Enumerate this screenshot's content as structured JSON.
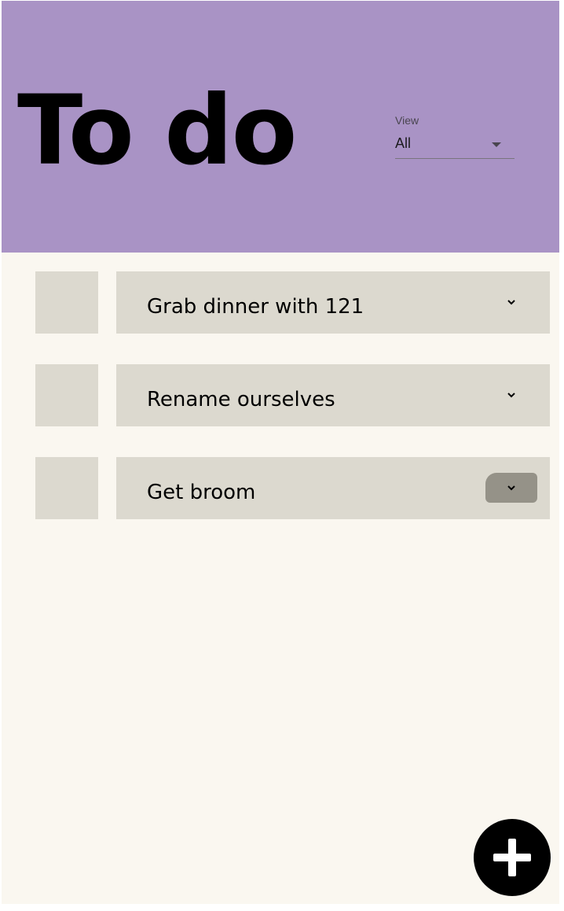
{
  "header": {
    "title": "To do",
    "background_color": "#a993c5"
  },
  "view_select": {
    "label": "View",
    "value": "All",
    "icon": "caret-down-icon"
  },
  "tasks": [
    {
      "text": "Grab dinner with 121",
      "expand_icon": "chevron-down-icon",
      "expanded_hover": false
    },
    {
      "text": "Rename ourselves",
      "expand_icon": "chevron-down-icon",
      "expanded_hover": false
    },
    {
      "text": "Get broom",
      "expand_icon": "chevron-down-icon",
      "expanded_hover": true
    }
  ],
  "fab": {
    "icon": "plus-icon",
    "color": "#000000"
  },
  "colors": {
    "background": "#faf7f0",
    "card": "#dcd9cf",
    "active_button": "#959288"
  }
}
